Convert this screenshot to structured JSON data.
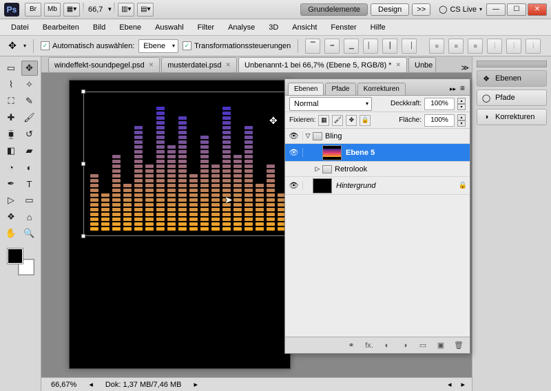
{
  "app": {
    "logo": "Ps"
  },
  "titlebar": {
    "br": "Br",
    "mb": "Mb",
    "zoom": "66,7",
    "pill_grund": "Grundelemente",
    "pill_design": "Design",
    "chev": ">>",
    "cslive": "CS Live"
  },
  "menu": [
    "Datei",
    "Bearbeiten",
    "Bild",
    "Ebene",
    "Auswahl",
    "Filter",
    "Analyse",
    "3D",
    "Ansicht",
    "Fenster",
    "Hilfe"
  ],
  "options": {
    "auto_label": "Automatisch auswählen:",
    "auto_target": "Ebene",
    "transform_label": "Transformationssteuerungen"
  },
  "doctabs": {
    "t1": "windeffekt-soundpegel.psd",
    "t2": "musterdatei.psd",
    "t3": "Unbenannt-1 bei 66,7% (Ebene 5, RGB/8) *",
    "t4": "Unbe"
  },
  "status": {
    "zoom": "66,67%",
    "docinfo": "Dok: 1,37 MB/7,46 MB"
  },
  "panel": {
    "tabs": {
      "ebenen": "Ebenen",
      "pfade": "Pfade",
      "korr": "Korrekturen"
    },
    "blend_mode": "Normal",
    "opacity_label": "Deckkraft:",
    "opacity_val": "100%",
    "lock_label": "Fixieren:",
    "fill_label": "Fläche:",
    "fill_val": "100%",
    "layers": {
      "group": "Bling",
      "l5": "Ebene 5",
      "retro": "Retrolook",
      "bg": "Hintergrund"
    }
  },
  "dock": {
    "ebenen": "Ebenen",
    "pfade": "Pfade",
    "korr": "Korrekturen"
  }
}
